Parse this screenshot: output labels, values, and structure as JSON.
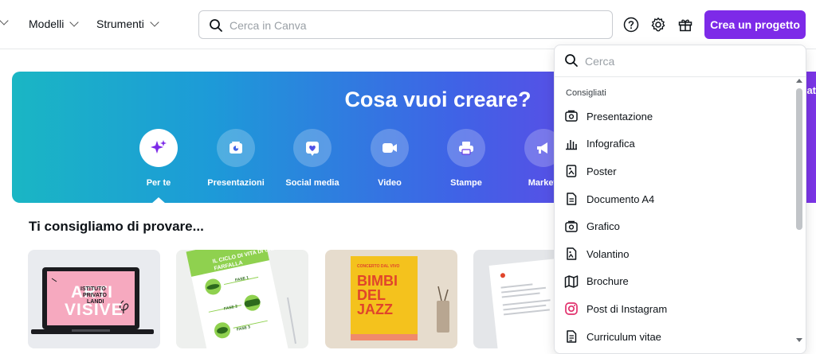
{
  "nav": {
    "items": [
      {
        "label": "Modelli"
      },
      {
        "label": "Strumenti"
      }
    ]
  },
  "search": {
    "placeholder": "Cerca in Canva"
  },
  "header": {
    "create_label": "Crea un progetto"
  },
  "hero": {
    "title": "Cosa vuoi creare?",
    "edge_text": "zat",
    "categories": [
      {
        "label": "Per te",
        "icon": "sparkle-icon"
      },
      {
        "label": "Presentazioni",
        "icon": "presentation-icon"
      },
      {
        "label": "Social media",
        "icon": "heart-icon"
      },
      {
        "label": "Video",
        "icon": "video-icon"
      },
      {
        "label": "Stampe",
        "icon": "printer-icon"
      },
      {
        "label": "Marketi",
        "icon": "megaphone-icon"
      }
    ]
  },
  "section": {
    "title": "Ti consigliamo di provare..."
  },
  "cards": [
    {
      "line1": "ARTI",
      "line2": "VISIVE",
      "sub1": "ISTITUTO",
      "sub2": "PRIVATO",
      "sub3": "LANDI"
    },
    {
      "headline": "IL CICLO DI VITA DI UNA FARFALLA",
      "step1": "FASE 1",
      "step2": "FASE 2",
      "step3": "FASE 3"
    },
    {
      "kicker": "CONCERTO DAL VIVO",
      "line1": "BIMBI",
      "line2": "DEL",
      "line3": "JAZZ"
    },
    {}
  ],
  "dropdown": {
    "placeholder": "Cerca",
    "section_label": "Consigliati",
    "items": [
      {
        "label": "Presentazione",
        "icon": "presentation-icon"
      },
      {
        "label": "Infografica",
        "icon": "bar-chart-icon"
      },
      {
        "label": "Poster",
        "icon": "poster-icon"
      },
      {
        "label": "Documento A4",
        "icon": "document-icon"
      },
      {
        "label": "Grafico",
        "icon": "chart-icon"
      },
      {
        "label": "Volantino",
        "icon": "flyer-icon"
      },
      {
        "label": "Brochure",
        "icon": "map-icon"
      },
      {
        "label": "Post di Instagram",
        "icon": "instagram-icon"
      },
      {
        "label": "Curriculum vitae",
        "icon": "resume-icon"
      }
    ]
  },
  "colors": {
    "accent": "#7d2ae8",
    "instagram": "#e1306c"
  }
}
